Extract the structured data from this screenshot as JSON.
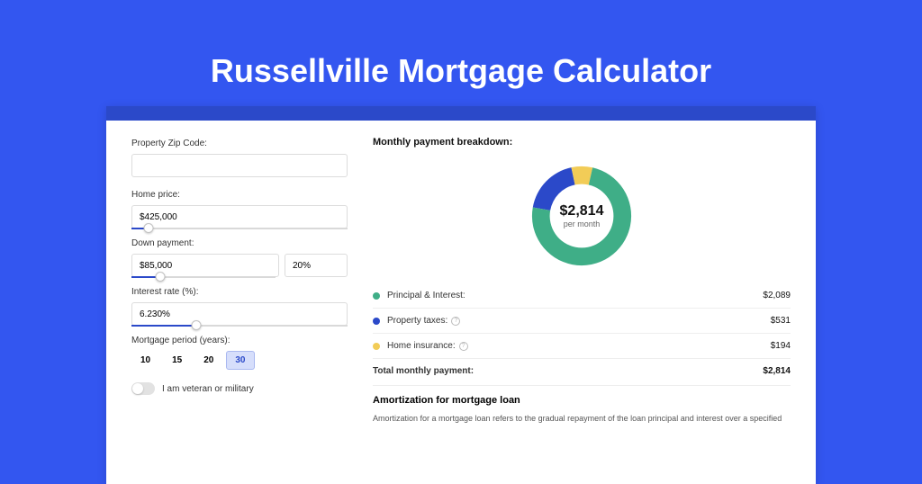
{
  "title": "Russellville Mortgage Calculator",
  "form": {
    "zip_label": "Property Zip Code:",
    "zip_value": "",
    "home_price_label": "Home price:",
    "home_price_value": "$425,000",
    "home_price_slider_pct": 8,
    "down_payment_label": "Down payment:",
    "down_payment_amount": "$85,000",
    "down_payment_percent": "20%",
    "down_payment_slider_pct": 20,
    "interest_label": "Interest rate (%):",
    "interest_value": "6.230%",
    "interest_slider_pct": 30,
    "period_label": "Mortgage period (years):",
    "period_options": [
      "10",
      "15",
      "20",
      "30"
    ],
    "period_selected_index": 3,
    "veteran_label": "I am veteran or military"
  },
  "breakdown": {
    "title": "Monthly payment breakdown:",
    "center_amount": "$2,814",
    "center_sub": "per month",
    "items": [
      {
        "label": "Principal & Interest:",
        "value": "$2,089",
        "color": "green",
        "help": false,
        "num": 2089
      },
      {
        "label": "Property taxes:",
        "value": "$531",
        "color": "blue",
        "help": true,
        "num": 531
      },
      {
        "label": "Home insurance:",
        "value": "$194",
        "color": "yellow",
        "help": true,
        "num": 194
      }
    ],
    "total_label": "Total monthly payment:",
    "total_value": "$2,814"
  },
  "amort": {
    "title": "Amortization for mortgage loan",
    "text": "Amortization for a mortgage loan refers to the gradual repayment of the loan principal and interest over a specified"
  },
  "chart_data": {
    "type": "pie",
    "title": "Monthly payment breakdown",
    "series": [
      {
        "name": "Principal & Interest",
        "value": 2089,
        "color": "#3fae87"
      },
      {
        "name": "Property taxes",
        "value": 531,
        "color": "#2b49c9"
      },
      {
        "name": "Home insurance",
        "value": 194,
        "color": "#f2cc57"
      }
    ],
    "total": 2814,
    "center_label": "$2,814 per month"
  }
}
